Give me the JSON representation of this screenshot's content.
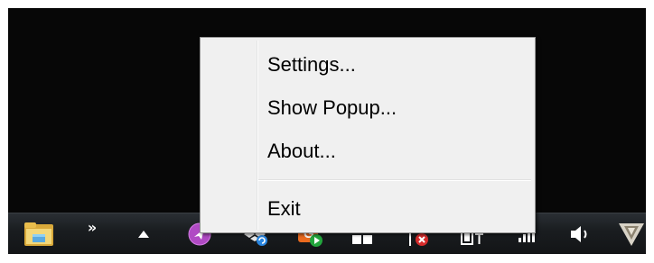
{
  "context_menu": {
    "items": [
      {
        "label": "Settings..."
      },
      {
        "label": "Show Popup..."
      },
      {
        "label": "About..."
      }
    ],
    "exit_label": "Exit"
  },
  "taskbar": {
    "overflow_chevron": "»",
    "tray_icons": [
      "file-explorer-icon",
      "overflow-chevron-icon",
      "show-hidden-icons-arrow",
      "purple-app-icon",
      "dropbox-icon",
      "orange-app-icon",
      "windows-flag-icon",
      "action-center-icon",
      "power-icon",
      "network-signal-icon",
      "volume-icon",
      "vpn-shield-icon"
    ]
  },
  "colors": {
    "desktop_background": "#070707",
    "menu_background": "#f0f0f0",
    "menu_border": "#979797"
  }
}
